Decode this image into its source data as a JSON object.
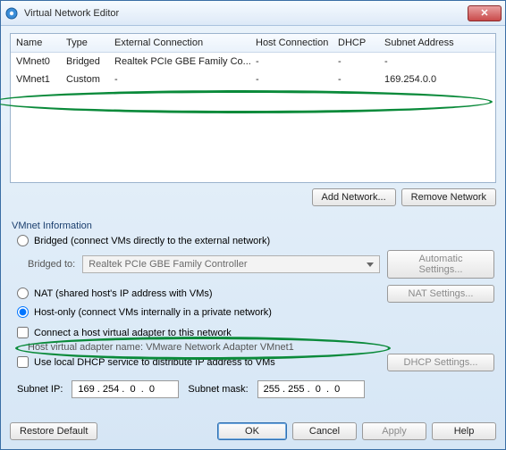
{
  "title": "Virtual Network Editor",
  "columns": {
    "name": "Name",
    "type": "Type",
    "ext": "External Connection",
    "host": "Host Connection",
    "dhcp": "DHCP",
    "subnet": "Subnet Address"
  },
  "rows": [
    {
      "name": "VMnet0",
      "type": "Bridged",
      "ext": "Realtek PCIe GBE Family Co...",
      "host": "-",
      "dhcp": "-",
      "subnet": "-"
    },
    {
      "name": "VMnet1",
      "type": "Custom",
      "ext": "-",
      "host": "-",
      "dhcp": "-",
      "subnet": "169.254.0.0"
    }
  ],
  "buttons": {
    "addNetwork": "Add Network...",
    "removeNetwork": "Remove Network",
    "autoSettings": "Automatic Settings...",
    "natSettings": "NAT Settings...",
    "dhcpSettings": "DHCP Settings...",
    "restore": "Restore Default",
    "ok": "OK",
    "cancel": "Cancel",
    "apply": "Apply",
    "help": "Help"
  },
  "group": {
    "title": "VMnet Information",
    "bridged": "Bridged (connect VMs directly to the external network)",
    "bridgedToLabel": "Bridged to:",
    "bridgedToValue": "Realtek PCIe GBE Family Controller",
    "nat": "NAT (shared host's IP address with VMs)",
    "hostonly": "Host-only (connect VMs internally in a private network)",
    "connectHost": "Connect a host virtual adapter to this network",
    "hostAdapterName": "Host virtual adapter name: VMware Network Adapter VMnet1",
    "useDhcp": "Use local DHCP service to distribute IP address to VMs",
    "subnetIpLabel": "Subnet IP:",
    "subnetIp": "169 . 254 .  0  .  0",
    "subnetMaskLabel": "Subnet mask:",
    "subnetMask": "255 . 255 .  0  .  0"
  }
}
